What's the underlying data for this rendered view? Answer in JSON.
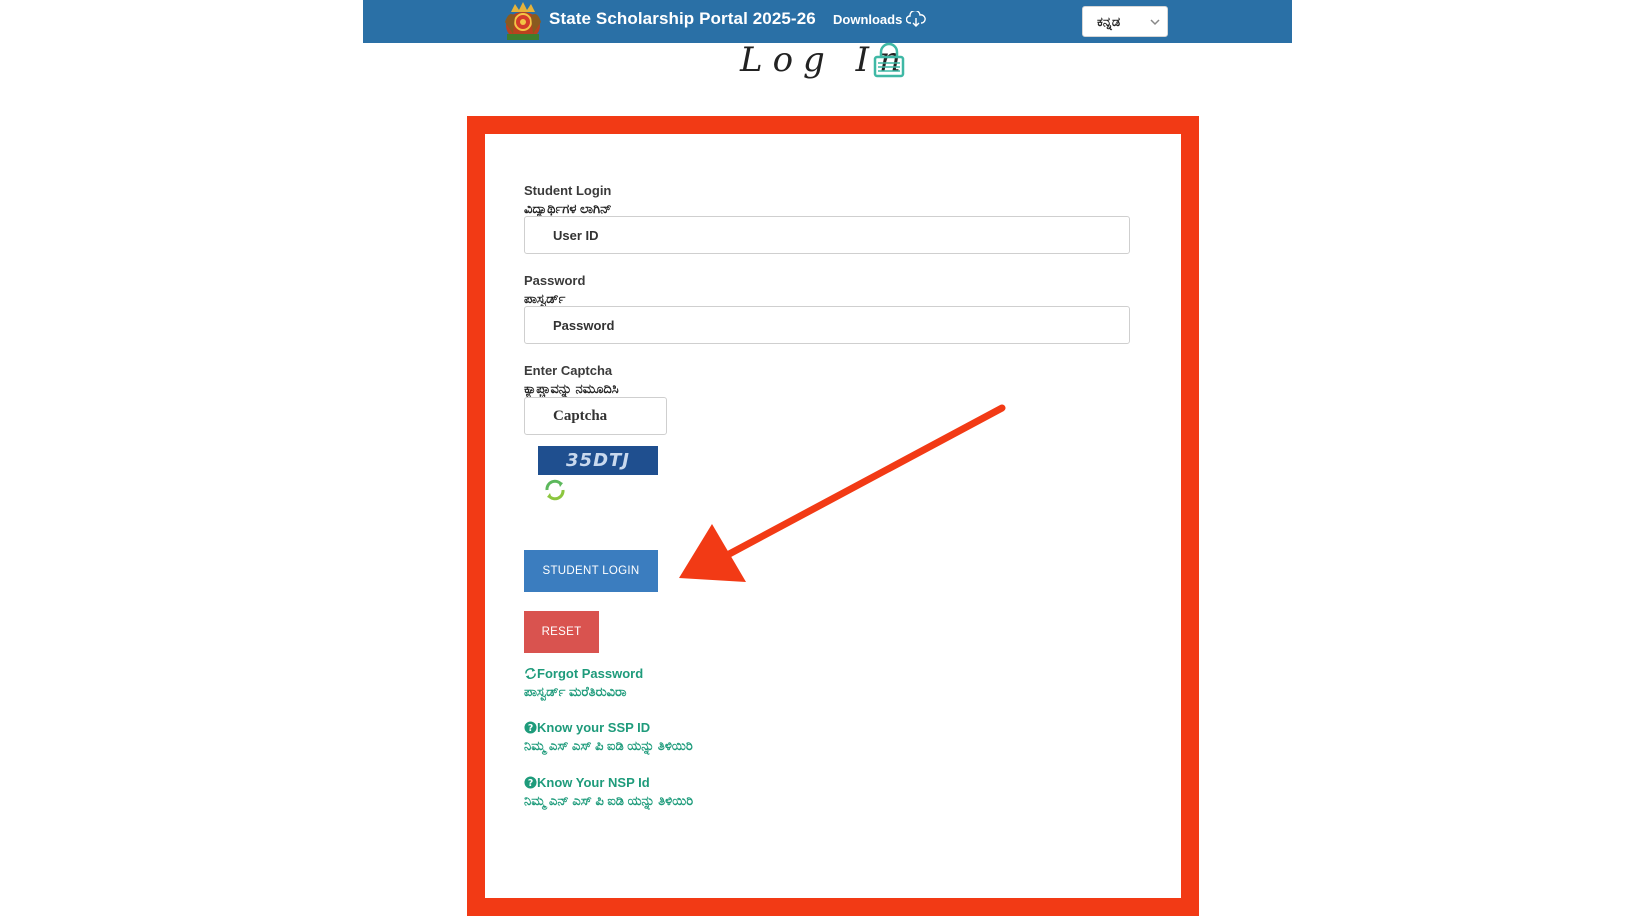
{
  "header": {
    "title": "State Scholarship Portal 2025-26",
    "downloads_label": "Downloads",
    "language_selected": "ಕನ್ನಡ"
  },
  "page_heading": "Log In",
  "student_login": {
    "label_en": "Student Login",
    "label_kn": "ವಿದ್ಯಾರ್ಥಿಗಳ ಲಾಗಿನ್",
    "user_id_placeholder": "User ID"
  },
  "password": {
    "label_en": "Password",
    "label_kn": "ಪಾಸ್ವರ್ಡ್",
    "placeholder": "Password"
  },
  "captcha": {
    "label_en": "Enter Captcha",
    "label_kn": "ಕ್ಯಾಪ್ಚಾವನ್ನು ನಮೂದಿಸಿ",
    "placeholder": "Captcha",
    "code": "35DTJ"
  },
  "buttons": {
    "login": "STUDENT LOGIN",
    "reset": "RESET"
  },
  "links": {
    "forgot_en": "Forgot Password",
    "forgot_kn": "ಪಾಸ್ವರ್ಡ್ ಮರೆತಿರುವಿರಾ",
    "ssp_en": "Know your SSP ID",
    "ssp_kn": "ನಿಮ್ಮ ಎಸ್ ಎಸ್ ಪಿ ಐಡಿ ಯನ್ನು ತಿಳಿಯಿರಿ",
    "nsp_en": "Know Your NSP Id",
    "nsp_kn": "ನಿಮ್ಮ ಎನ್ ಎಸ್ ಪಿ ಐಡಿ ಯನ್ನು ತಿಳಿಯಿರಿ"
  },
  "colors": {
    "header_bg": "#2a70a6",
    "frame": "#f23a15",
    "login_button": "#3b7dbf",
    "reset_button": "#d9534f",
    "link": "#1e9b7b"
  }
}
